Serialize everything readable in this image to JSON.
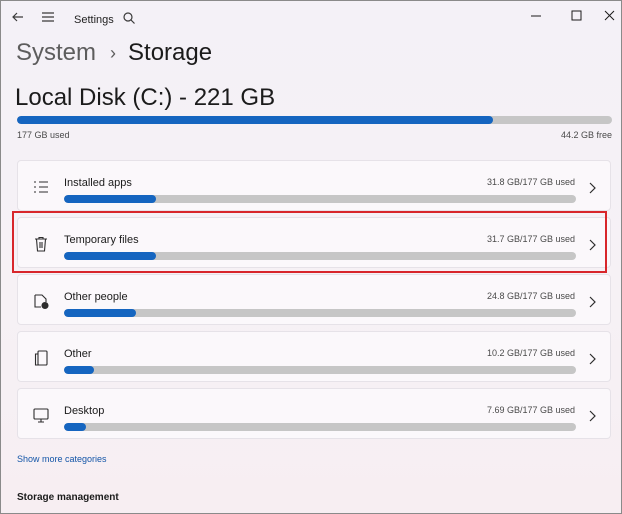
{
  "window": {
    "title": "Settings"
  },
  "breadcrumb": {
    "parent": "System",
    "separator": "›",
    "current": "Storage"
  },
  "disk": {
    "title": "Local Disk (C:) - 221 GB",
    "used_label": "177 GB used",
    "free_label": "44.2 GB free",
    "used_fraction": 0.8
  },
  "categories": [
    {
      "label": "Installed apps",
      "usage": "31.8 GB/177 GB used",
      "fraction": 0.18,
      "icon": "apps-list-icon"
    },
    {
      "label": "Temporary files",
      "usage": "31.7 GB/177 GB used",
      "fraction": 0.179,
      "icon": "trash-icon"
    },
    {
      "label": "Other people",
      "usage": "24.8 GB/177 GB used",
      "fraction": 0.14,
      "icon": "other-people-icon"
    },
    {
      "label": "Other",
      "usage": "10.2 GB/177 GB used",
      "fraction": 0.058,
      "icon": "other-file-icon"
    },
    {
      "label": "Desktop",
      "usage": "7.69 GB/177 GB used",
      "fraction": 0.043,
      "icon": "desktop-icon"
    }
  ],
  "links": {
    "show_more": "Show more categories"
  },
  "sections": {
    "storage_management": "Storage management"
  },
  "colors": {
    "accent": "#1565c0",
    "bar_track": "#c6c6c6",
    "highlight": "#d8262b"
  }
}
